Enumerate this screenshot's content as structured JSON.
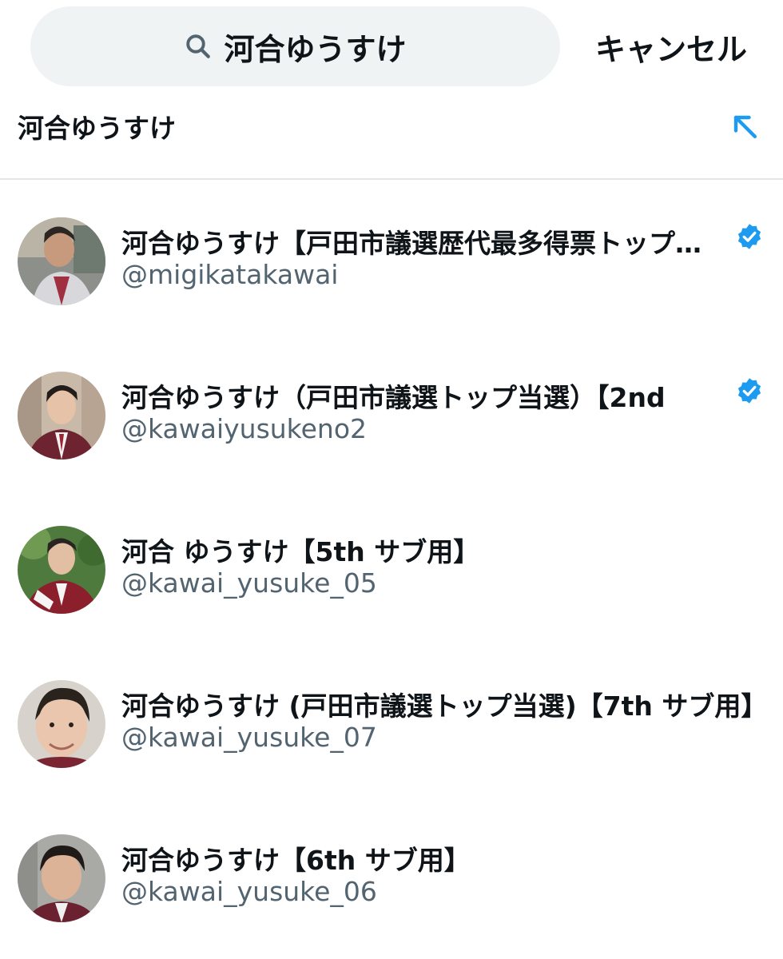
{
  "search": {
    "query": "河合ゆうすけ",
    "cancel_label": "キャンセル"
  },
  "suggestion": {
    "text": "河合ゆうすけ",
    "icon": "arrow-up-left-icon"
  },
  "results": [
    {
      "name": "河合ゆうすけ【戸田市議選歴代最多得票トップ当選】",
      "handle": "@migikatakawai",
      "verified": true
    },
    {
      "name": "河合ゆうすけ（戸田市議選トップ当選）【2nd",
      "handle": "@kawaiyusukeno2",
      "verified": true
    },
    {
      "name": "河合 ゆうすけ【5th サブ用】",
      "handle": "@kawai_yusuke_05",
      "verified": false
    },
    {
      "name": "河合ゆうすけ (戸田市議選トップ当選)【7th サブ用】",
      "handle": "@kawai_yusuke_07",
      "verified": false
    },
    {
      "name": "河合ゆうすけ【6th サブ用】",
      "handle": "@kawai_yusuke_06",
      "verified": false
    }
  ],
  "colors": {
    "search_bg": "#eff3f4",
    "primary_text": "#0f1419",
    "secondary_text": "#536471",
    "verified_blue": "#1d9bf0",
    "divider": "#e3e7ea"
  }
}
